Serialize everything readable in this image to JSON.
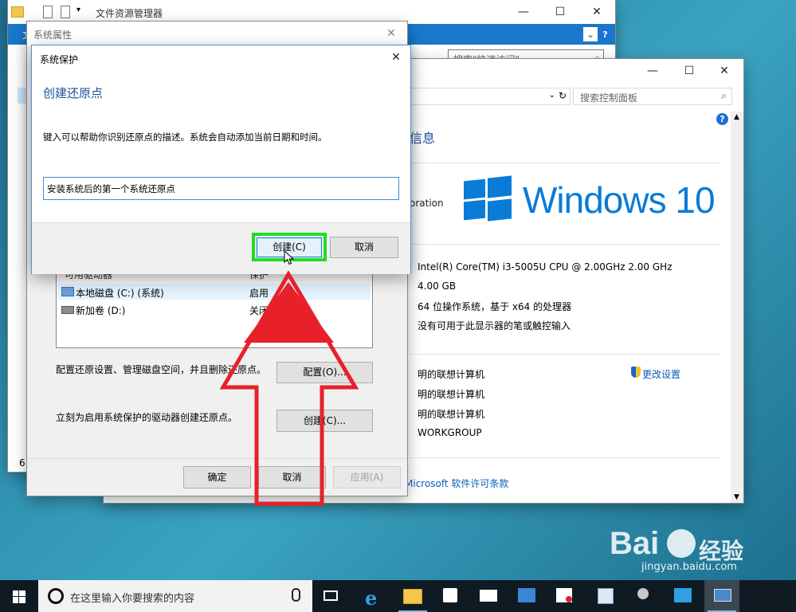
{
  "explorer": {
    "title": "文件资源管理器",
    "ribbon_tab": "文",
    "search_placeholder": "搜索\"快速访问\"",
    "status_count": "6"
  },
  "control_panel": {
    "search_placeholder": "搜索控制面板",
    "heading_partial": "信息",
    "corporation_partial": "oration",
    "win_logo_text": "Windows 10",
    "specs": [
      "Intel(R) Core(TM) i3-5005U CPU @ 2.00GHz   2.00 GHz",
      "4.00 GB",
      "64 位操作系统，基于 x64 的处理器",
      "没有可用于此显示器的笔或触控输入"
    ],
    "computer": [
      "明的联想计算机",
      "明的联想计算机",
      "明的联想计算机",
      "WORKGROUP"
    ],
    "change_settings": "更改设置",
    "license_link": "Microsoft 软件许可条款"
  },
  "sys_props": {
    "title": "系统属性",
    "drives_header": [
      "可用驱动器",
      "保护"
    ],
    "drives": [
      {
        "name": "本地磁盘 (C:) (系统)",
        "status": "启用"
      },
      {
        "name": "新加卷 (D:)",
        "status": "关闭"
      }
    ],
    "config_text": "配置还原设置、管理磁盘空间，并且删除还原点。",
    "config_button": "配置(O)...",
    "create_text": "立刻为启用系统保护的驱动器创建还原点。",
    "create_button": "创建(C)...",
    "ok": "确定",
    "cancel": "取消",
    "apply": "应用(A)"
  },
  "dialog": {
    "title": "系统保护",
    "heading": "创建还原点",
    "description": "键入可以帮助你识别还原点的描述。系统会自动添加当前日期和时间。",
    "input_value": "安装系统后的第一个系统还原点",
    "create_button": "创建(C)",
    "cancel_button": "取消"
  },
  "taskbar": {
    "search_placeholder": "在这里输入你要搜索的内容"
  },
  "watermark": {
    "brand": "Bai",
    "brand2": "经验",
    "url": "jingyan.baidu.com"
  },
  "colors": {
    "highlight_green": "#22dd22",
    "arrow_red": "#e8202a",
    "heading_blue": "#1f4e9e",
    "win_blue": "#0078d7"
  }
}
